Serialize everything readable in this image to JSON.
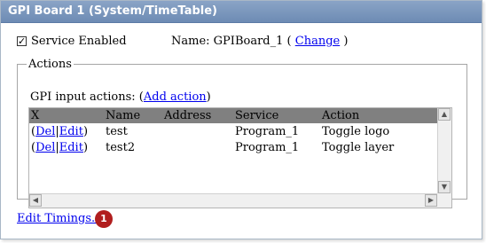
{
  "title": "GPI Board 1 (System/TimeTable)",
  "service_enabled": {
    "label": "Service Enabled",
    "checked_glyph": "✓"
  },
  "name_row": {
    "prefix": "Name:",
    "value": "GPIBoard_1",
    "open": "(",
    "link": "Change",
    "close": ")"
  },
  "actions": {
    "legend": "Actions",
    "gpi_label": "GPI input actions:",
    "add_open": "(",
    "add_link": "Add action",
    "add_close": ")",
    "columns": [
      "X",
      "Name",
      "Address",
      "Service",
      "Action"
    ],
    "rows": [
      {
        "del": "Del",
        "sep": "|",
        "edit": "Edit",
        "name": "test",
        "address": "",
        "service": "Program_1",
        "action": "Toggle logo"
      },
      {
        "del": "Del",
        "sep": "|",
        "edit": "Edit",
        "name": "test2",
        "address": "",
        "service": "Program_1",
        "action": "Toggle layer"
      }
    ]
  },
  "edit_timings": "Edit Timings...",
  "badge": "1"
}
